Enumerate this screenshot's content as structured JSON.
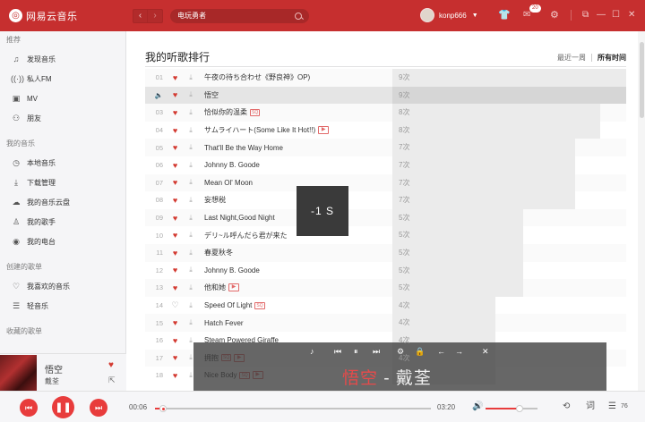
{
  "app": {
    "name": "网易云音乐",
    "logo_glyph": "◎"
  },
  "search": {
    "query": "电玩勇者"
  },
  "user": {
    "name": "konp666"
  },
  "topbar": {
    "message_badge": "20"
  },
  "sidebar": {
    "sections": [
      {
        "title": "推荐",
        "items": [
          {
            "icon": "music-note-icon",
            "glyph": "♫",
            "label": "发现音乐"
          },
          {
            "icon": "radio-icon",
            "glyph": "((·))",
            "label": "私人FM"
          },
          {
            "icon": "video-icon",
            "glyph": "▣",
            "label": "MV"
          },
          {
            "icon": "friends-icon",
            "glyph": "⚇",
            "label": "朋友"
          }
        ]
      },
      {
        "title": "我的音乐",
        "items": [
          {
            "icon": "local-music-icon",
            "glyph": "◷",
            "label": "本地音乐"
          },
          {
            "icon": "download-icon",
            "glyph": "⤓",
            "label": "下载管理"
          },
          {
            "icon": "cloud-icon",
            "glyph": "☁",
            "label": "我的音乐云盘"
          },
          {
            "icon": "singer-icon",
            "glyph": "♙",
            "label": "我的歌手"
          },
          {
            "icon": "station-icon",
            "glyph": "◉",
            "label": "我的电台"
          }
        ]
      },
      {
        "title": "创建的歌单",
        "items": [
          {
            "icon": "heart-outline-icon",
            "glyph": "♡",
            "label": "我喜欢的音乐"
          },
          {
            "icon": "playlist-icon",
            "glyph": "☰",
            "label": "轻音乐"
          }
        ]
      },
      {
        "title": "收藏的歌单",
        "items": []
      }
    ],
    "now_playing": {
      "title": "悟空",
      "artist": "戴荃"
    }
  },
  "main": {
    "title": "我的听歌排行",
    "tabs": [
      "最近一周",
      "所有时间"
    ],
    "rows": [
      {
        "num": "01",
        "title": "午夜の待ち合わせ《野良神》OP)",
        "count": "9次",
        "ratio": 1.0,
        "loved": true
      },
      {
        "num": "",
        "title": "悟空",
        "count": "9次",
        "ratio": 1.0,
        "loved": true,
        "playing": true
      },
      {
        "num": "03",
        "title": "恰似你的温柔",
        "count": "8次",
        "ratio": 0.89,
        "loved": true,
        "sq": "SQ"
      },
      {
        "num": "04",
        "title": "サムライハート(Some Like It Hot!!)",
        "count": "8次",
        "ratio": 0.89,
        "loved": true,
        "mv": "▶"
      },
      {
        "num": "05",
        "title": "That'll Be the Way Home",
        "count": "7次",
        "ratio": 0.78,
        "loved": true
      },
      {
        "num": "06",
        "title": "Johnny B. Goode",
        "count": "7次",
        "ratio": 0.78,
        "loved": true
      },
      {
        "num": "07",
        "title": "Mean Ol' Moon",
        "count": "7次",
        "ratio": 0.78,
        "loved": true
      },
      {
        "num": "08",
        "title": "妄想税",
        "count": "7次",
        "ratio": 0.78,
        "loved": true
      },
      {
        "num": "09",
        "title": "Last Night,Good Night",
        "count": "5次",
        "ratio": 0.56,
        "loved": true
      },
      {
        "num": "10",
        "title": "デリ~ル呼んだら君が来た",
        "count": "5次",
        "ratio": 0.56,
        "loved": true
      },
      {
        "num": "11",
        "title": "春夏秋冬",
        "count": "5次",
        "ratio": 0.56,
        "loved": true
      },
      {
        "num": "12",
        "title": "Johnny B. Goode",
        "count": "5次",
        "ratio": 0.56,
        "loved": true
      },
      {
        "num": "13",
        "title": "他和她",
        "count": "5次",
        "ratio": 0.56,
        "loved": true,
        "mv": "▶"
      },
      {
        "num": "14",
        "title": "Speed Of Light",
        "count": "4次",
        "ratio": 0.44,
        "loved": false,
        "sq": "SQ"
      },
      {
        "num": "15",
        "title": "Hatch Fever",
        "count": "4次",
        "ratio": 0.44,
        "loved": true
      },
      {
        "num": "16",
        "title": "Steam Powered Giraffe",
        "count": "4次",
        "ratio": 0.44,
        "loved": true
      },
      {
        "num": "17",
        "title": "拥抱",
        "count": "4次",
        "ratio": 0.44,
        "loved": true,
        "sq": "SQ",
        "mv": "▶"
      },
      {
        "num": "18",
        "title": "Nice Body",
        "count": "4次",
        "ratio": 0.44,
        "loved": true,
        "sq": "SQ",
        "mv": "▶"
      }
    ]
  },
  "toast": {
    "text": "-1 S"
  },
  "lyric": {
    "sung": "悟空",
    "dash": " - ",
    "rest": "戴荃"
  },
  "player": {
    "current": "00:06",
    "total": "03:20",
    "progress": 0.03,
    "volume": 0.65,
    "playlist_count": "76"
  },
  "colors": {
    "brand": "#c62f2f",
    "accent": "#e83c3c"
  }
}
